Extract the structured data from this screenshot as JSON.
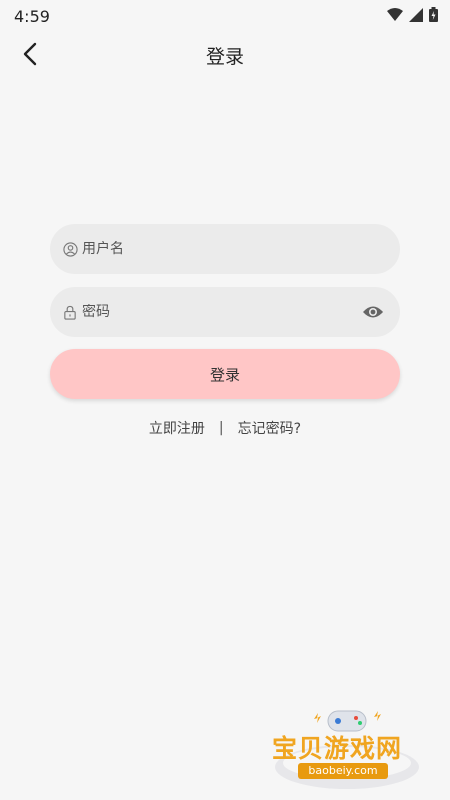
{
  "status_bar": {
    "time": "4:59",
    "icons": [
      "wifi-icon",
      "signal-icon",
      "battery-icon"
    ]
  },
  "app_bar": {
    "title": "登录",
    "back_icon": "chevron-left-icon"
  },
  "form": {
    "username": {
      "placeholder": "用户名",
      "value": "",
      "icon": "user-icon"
    },
    "password": {
      "placeholder": "密码",
      "value": "",
      "icon": "lock-icon",
      "toggle_icon": "eye-icon"
    },
    "submit_label": "登录"
  },
  "links": {
    "register": "立即注册",
    "separator": "|",
    "forgot": "忘记密码?"
  },
  "watermark": {
    "title": "宝贝游戏网",
    "url": "baobeiy.com"
  },
  "colors": {
    "background": "#f6f6f6",
    "field_bg": "#ebebeb",
    "button_bg": "#ffc6c6",
    "watermark": "#f0a520"
  }
}
